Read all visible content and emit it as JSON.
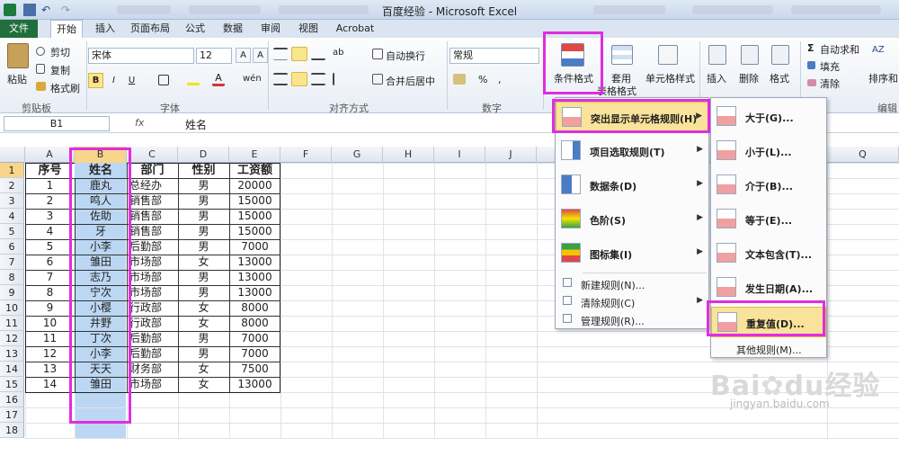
{
  "window": {
    "title": "百度经验 - Microsoft Excel"
  },
  "tabs": [
    "文件",
    "开始",
    "插入",
    "页面布局",
    "公式",
    "数据",
    "审阅",
    "视图",
    "Acrobat"
  ],
  "clipboard": {
    "paste": "粘贴",
    "cut": "剪切",
    "copy": "复制",
    "format_painter": "格式刷",
    "group": "剪贴板"
  },
  "font": {
    "name": "宋体",
    "size": "12",
    "bold": "B",
    "italic": "I",
    "underline": "U",
    "phonetic": "wén",
    "group": "字体"
  },
  "alignment": {
    "wrap": "自动换行",
    "merge": "合并后居中",
    "group": "对齐方式"
  },
  "number": {
    "format": "常规",
    "percent": "%",
    "comma": ",",
    "group": "数字"
  },
  "styles": {
    "cond_format": "条件格式",
    "table_format_1": "套用",
    "table_format_2": "表格格式",
    "cell_styles": "单元格样式"
  },
  "cells": {
    "insert": "插入",
    "delete": "删除",
    "format": "格式"
  },
  "editing": {
    "autosum": "自动求和",
    "fill": "填充",
    "clear": "清除",
    "sort": "排序和",
    "group": "编辑"
  },
  "formula_bar": {
    "cell_ref": "B1",
    "fx": "fx",
    "value": "姓名"
  },
  "columns": [
    "A",
    "B",
    "C",
    "D",
    "E",
    "F",
    "G",
    "H",
    "I",
    "J",
    "Q"
  ],
  "row_numbers": [
    "1",
    "2",
    "3",
    "4",
    "5",
    "6",
    "7",
    "8",
    "9",
    "10",
    "11",
    "12",
    "13",
    "14",
    "15",
    "16",
    "17",
    "18"
  ],
  "table": {
    "headers": [
      "序号",
      "姓名",
      "部门",
      "性别",
      "工资额"
    ],
    "rows": [
      [
        "1",
        "鹿丸",
        "总经办",
        "男",
        "20000"
      ],
      [
        "2",
        "鸣人",
        "销售部",
        "男",
        "15000"
      ],
      [
        "3",
        "佐助",
        "销售部",
        "男",
        "15000"
      ],
      [
        "4",
        "牙",
        "销售部",
        "男",
        "15000"
      ],
      [
        "5",
        "小李",
        "后勤部",
        "男",
        "7000"
      ],
      [
        "6",
        "雏田",
        "市场部",
        "女",
        "13000"
      ],
      [
        "7",
        "志乃",
        "市场部",
        "男",
        "13000"
      ],
      [
        "8",
        "宁次",
        "市场部",
        "男",
        "13000"
      ],
      [
        "9",
        "小樱",
        "行政部",
        "女",
        "8000"
      ],
      [
        "10",
        "井野",
        "行政部",
        "女",
        "8000"
      ],
      [
        "11",
        "丁次",
        "后勤部",
        "男",
        "7000"
      ],
      [
        "12",
        "小李",
        "后勤部",
        "男",
        "7000"
      ],
      [
        "13",
        "天天",
        "财务部",
        "女",
        "7500"
      ],
      [
        "14",
        "雏田",
        "市场部",
        "女",
        "13000"
      ]
    ]
  },
  "cf_menu": [
    "突出显示单元格规则(H)",
    "项目选取规则(T)",
    "数据条(D)",
    "色阶(S)",
    "图标集(I)",
    "新建规则(N)...",
    "清除规则(C)",
    "管理规则(R)..."
  ],
  "highlight_submenu": [
    "大于(G)...",
    "小于(L)...",
    "介于(B)...",
    "等于(E)...",
    "文本包含(T)...",
    "发生日期(A)...",
    "重复值(D)...",
    "其他规则(M)..."
  ],
  "watermark": {
    "brand": "Bai",
    "brand2": "经验",
    "url": "jingyan.baidu.com"
  },
  "colors": {
    "highlight": "#e02de0",
    "selection": "#bcd7f3",
    "file_tab": "#1f6e3b"
  }
}
